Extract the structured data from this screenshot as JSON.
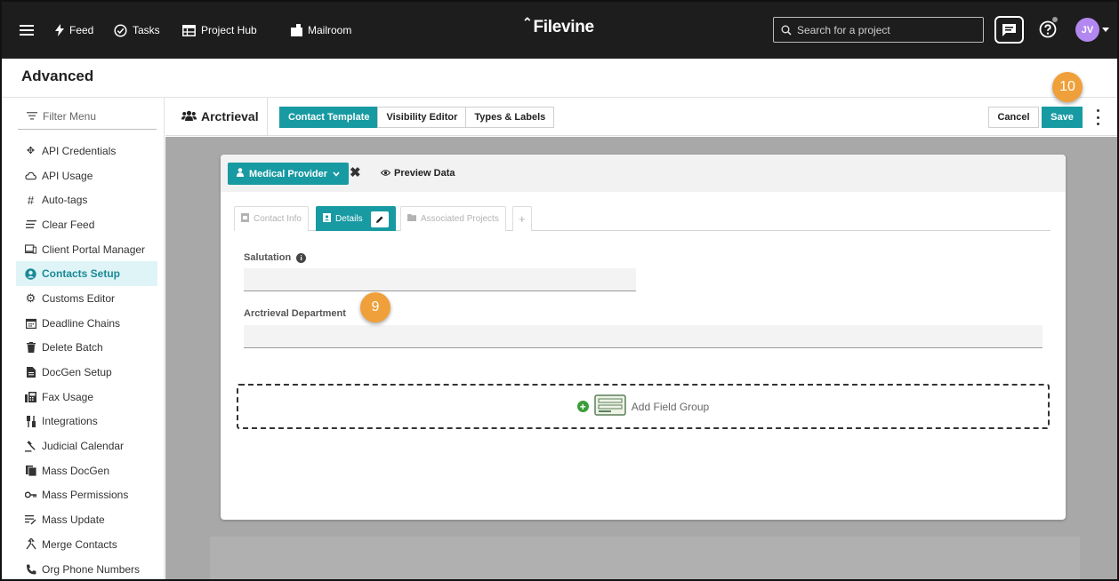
{
  "colors": {
    "nav_bg": "#1d1d1d",
    "accent": "#189aa3",
    "active_menu_bg": "#dff4f6",
    "step_badge": "#f0a03a",
    "avatar": "#b287f0",
    "canvas": "#a8a8a8"
  },
  "topnav": {
    "items": [
      {
        "label": "Feed",
        "icon": "bolt-icon"
      },
      {
        "label": "Tasks",
        "icon": "check-circle-icon"
      },
      {
        "label": "Project Hub",
        "icon": "table-icon"
      },
      {
        "label": "Mailroom",
        "icon": "mailbox-icon"
      }
    ],
    "logo": "Filevine",
    "search_placeholder": "Search for a project",
    "avatar_initials": "JV"
  },
  "page": {
    "title": "Advanced"
  },
  "sidebar": {
    "filter_placeholder": "Filter Menu",
    "items": [
      {
        "label": "API Credentials",
        "icon": "move-arrows-icon"
      },
      {
        "label": "API Usage",
        "icon": "cloud-icon"
      },
      {
        "label": "Auto-tags",
        "icon": "hash-icon"
      },
      {
        "label": "Clear Feed",
        "icon": "clear-lines-icon"
      },
      {
        "label": "Client Portal Manager",
        "icon": "devices-icon"
      },
      {
        "label": "Contacts Setup",
        "icon": "user-circle-icon",
        "active": true
      },
      {
        "label": "Customs Editor",
        "icon": "cog-icon"
      },
      {
        "label": "Deadline Chains",
        "icon": "calendar-icon"
      },
      {
        "label": "Delete Batch",
        "icon": "trash-icon"
      },
      {
        "label": "DocGen Setup",
        "icon": "document-icon"
      },
      {
        "label": "Fax Usage",
        "icon": "fax-icon"
      },
      {
        "label": "Integrations",
        "icon": "plug-icon"
      },
      {
        "label": "Judicial Calendar",
        "icon": "gavel-icon"
      },
      {
        "label": "Mass DocGen",
        "icon": "documents-icon"
      },
      {
        "label": "Mass Permissions",
        "icon": "key-icon"
      },
      {
        "label": "Mass Update",
        "icon": "edit-lines-icon"
      },
      {
        "label": "Merge Contacts",
        "icon": "merge-icon"
      },
      {
        "label": "Org Phone Numbers",
        "icon": "phone-icon"
      }
    ]
  },
  "toolbar": {
    "entity": "Arctrieval",
    "tabs": [
      "Contact Template",
      "Visibility Editor",
      "Types & Labels"
    ],
    "cancel": "Cancel",
    "save": "Save"
  },
  "editor": {
    "contact_type": "Medical Provider",
    "preview": "Preview Data",
    "subtabs": [
      "Contact Info",
      "Details",
      "Associated Projects",
      "+"
    ],
    "fields": [
      {
        "label": "Salutation",
        "value": ""
      },
      {
        "label": "Arctrieval Department",
        "value": ""
      }
    ],
    "add_group": "Add Field Group"
  },
  "badges": {
    "save_step": "10",
    "field_step": "9"
  }
}
